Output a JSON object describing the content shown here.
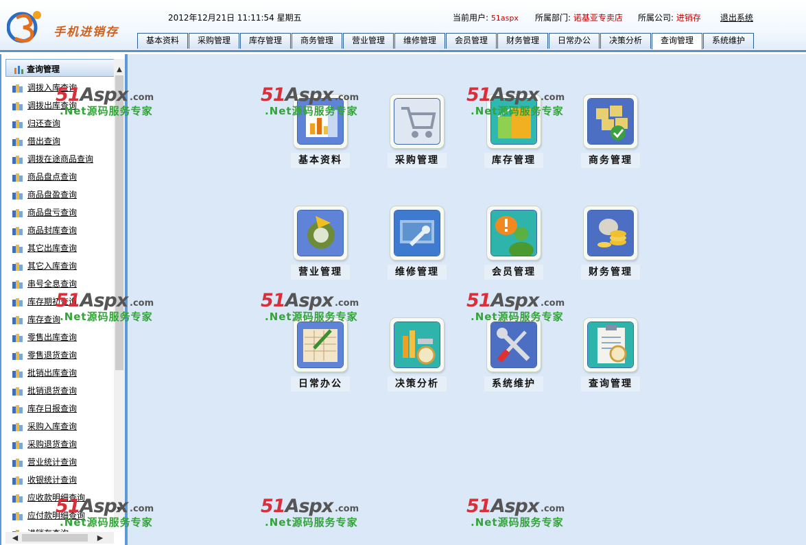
{
  "header": {
    "logo_text": "手机进销存",
    "datetime": "2012年12月21日 11:11:54 星期五",
    "user_label": "当前用户:",
    "user_value": "51aspx",
    "dept_label": "所属部门:",
    "dept_value": "诺基亚专卖店",
    "company_label": "所属公司:",
    "company_value": "进销存",
    "logout": "退出系统"
  },
  "nav": {
    "tabs": [
      "基本资料",
      "采购管理",
      "库存管理",
      "商务管理",
      "营业管理",
      "维修管理",
      "会员管理",
      "财务管理",
      "日常办公",
      "决策分析",
      "查询管理",
      "系统维护"
    ],
    "active": "查询管理"
  },
  "sidebar": {
    "title": "查询管理",
    "items": [
      "调拨入库查询",
      "调拨出库查询",
      "归还查询",
      "借出查询",
      "调拨在途商品查询",
      "商品盘点查询",
      "商品盘盈查询",
      "商品盘亏查询",
      "商品封库查询",
      "其它出库查询",
      "其它入库查询",
      "串号全息查询",
      "库存期初查询",
      "库存查询",
      "零售出库查询",
      "零售退货查询",
      "批销出库查询",
      "批销退货查询",
      "库存日报查询",
      "采购入库查询",
      "采购退货查询",
      "营业统计查询",
      "收银统计查询",
      "应收款明细查询",
      "应付款明细查询",
      "进销存查询"
    ]
  },
  "modules": [
    {
      "label": "基本资料",
      "icon": "chart-document-icon"
    },
    {
      "label": "采购管理",
      "icon": "shopping-cart-icon"
    },
    {
      "label": "库存管理",
      "icon": "warehouse-box-icon"
    },
    {
      "label": "商务管理",
      "icon": "cubes-check-icon"
    },
    {
      "label": "营业管理",
      "icon": "refresh-arrow-icon"
    },
    {
      "label": "维修管理",
      "icon": "repair-tools-icon"
    },
    {
      "label": "会员管理",
      "icon": "member-alert-icon"
    },
    {
      "label": "财务管理",
      "icon": "money-bag-coins-icon"
    },
    {
      "label": "日常办公",
      "icon": "notebook-pen-icon"
    },
    {
      "label": "决策分析",
      "icon": "chart-magnifier-icon"
    },
    {
      "label": "系统维护",
      "icon": "wrench-screwdriver-icon"
    },
    {
      "label": "查询管理",
      "icon": "clipboard-magnifier-icon"
    }
  ],
  "watermark": {
    "brand_a": "51",
    "brand_b": "Aspx",
    "brand_c": ".com",
    "sub": ".Net源码服务专家"
  },
  "colors": {
    "header_value_red": "#c00000",
    "border_blue": "#5b9ad6",
    "main_bg": "#dbe8f8",
    "watermark_red": "#d8303a",
    "watermark_green": "#33a33a"
  }
}
